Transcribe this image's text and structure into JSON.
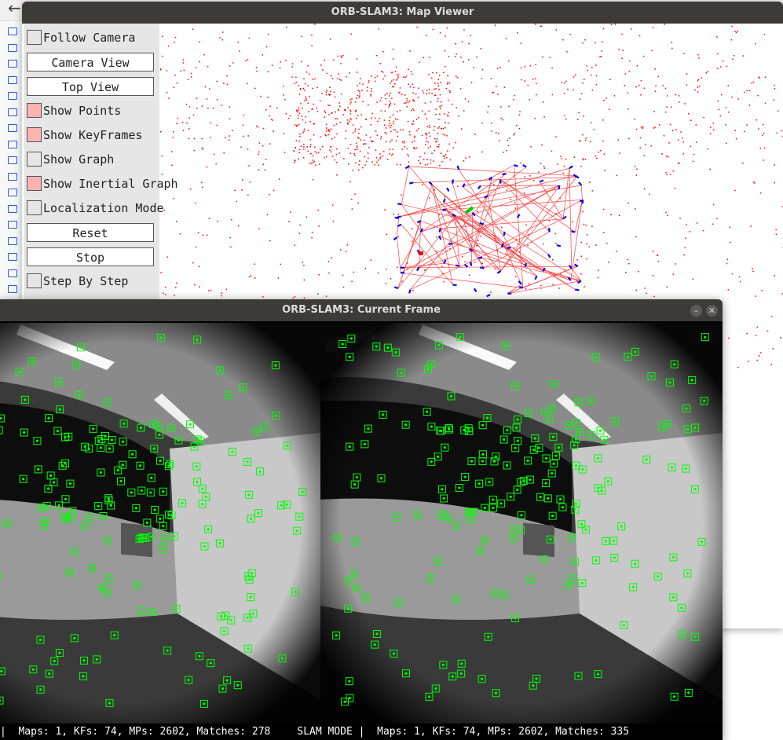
{
  "map_viewer": {
    "title": "ORB-SLAM3: Map Viewer",
    "controls": [
      {
        "type": "checkbox",
        "label": "Follow Camera",
        "checked": false
      },
      {
        "type": "button",
        "label": "Camera View"
      },
      {
        "type": "button",
        "label": "Top View"
      },
      {
        "type": "checkbox",
        "label": "Show Points",
        "checked": true
      },
      {
        "type": "checkbox",
        "label": "Show KeyFrames",
        "checked": true
      },
      {
        "type": "checkbox",
        "label": "Show Graph",
        "checked": false
      },
      {
        "type": "checkbox",
        "label": "Show Inertial Graph",
        "checked": true
      },
      {
        "type": "checkbox",
        "label": "Localization Mode",
        "checked": false
      },
      {
        "type": "button",
        "label": "Reset"
      },
      {
        "type": "button",
        "label": "Stop"
      },
      {
        "type": "checkbox",
        "label": "Step By Step",
        "checked": false
      }
    ],
    "colors": {
      "map_points": "#ff0000",
      "keyframes": "#0000ff",
      "current_camera": "#00cc00",
      "graph_edges": "#ff4040",
      "checked_box": "#ffb3b3"
    }
  },
  "current_frame": {
    "title": "ORB-SLAM3: Current Frame",
    "minimize_icon": "minimize-icon",
    "close_icon": "close-icon",
    "status_left": "|  Maps: 1, KFs: 74, MPs: 2602, Matches: 278",
    "status_mode": "SLAM MODE",
    "status_right": "|  Maps: 1, KFs: 74, MPs: 2602, Matches: 335",
    "feature_color": "#00ff00"
  },
  "background_app": {
    "back_icon": "arrow-left-icon",
    "folder_icon": "folder-icon"
  }
}
